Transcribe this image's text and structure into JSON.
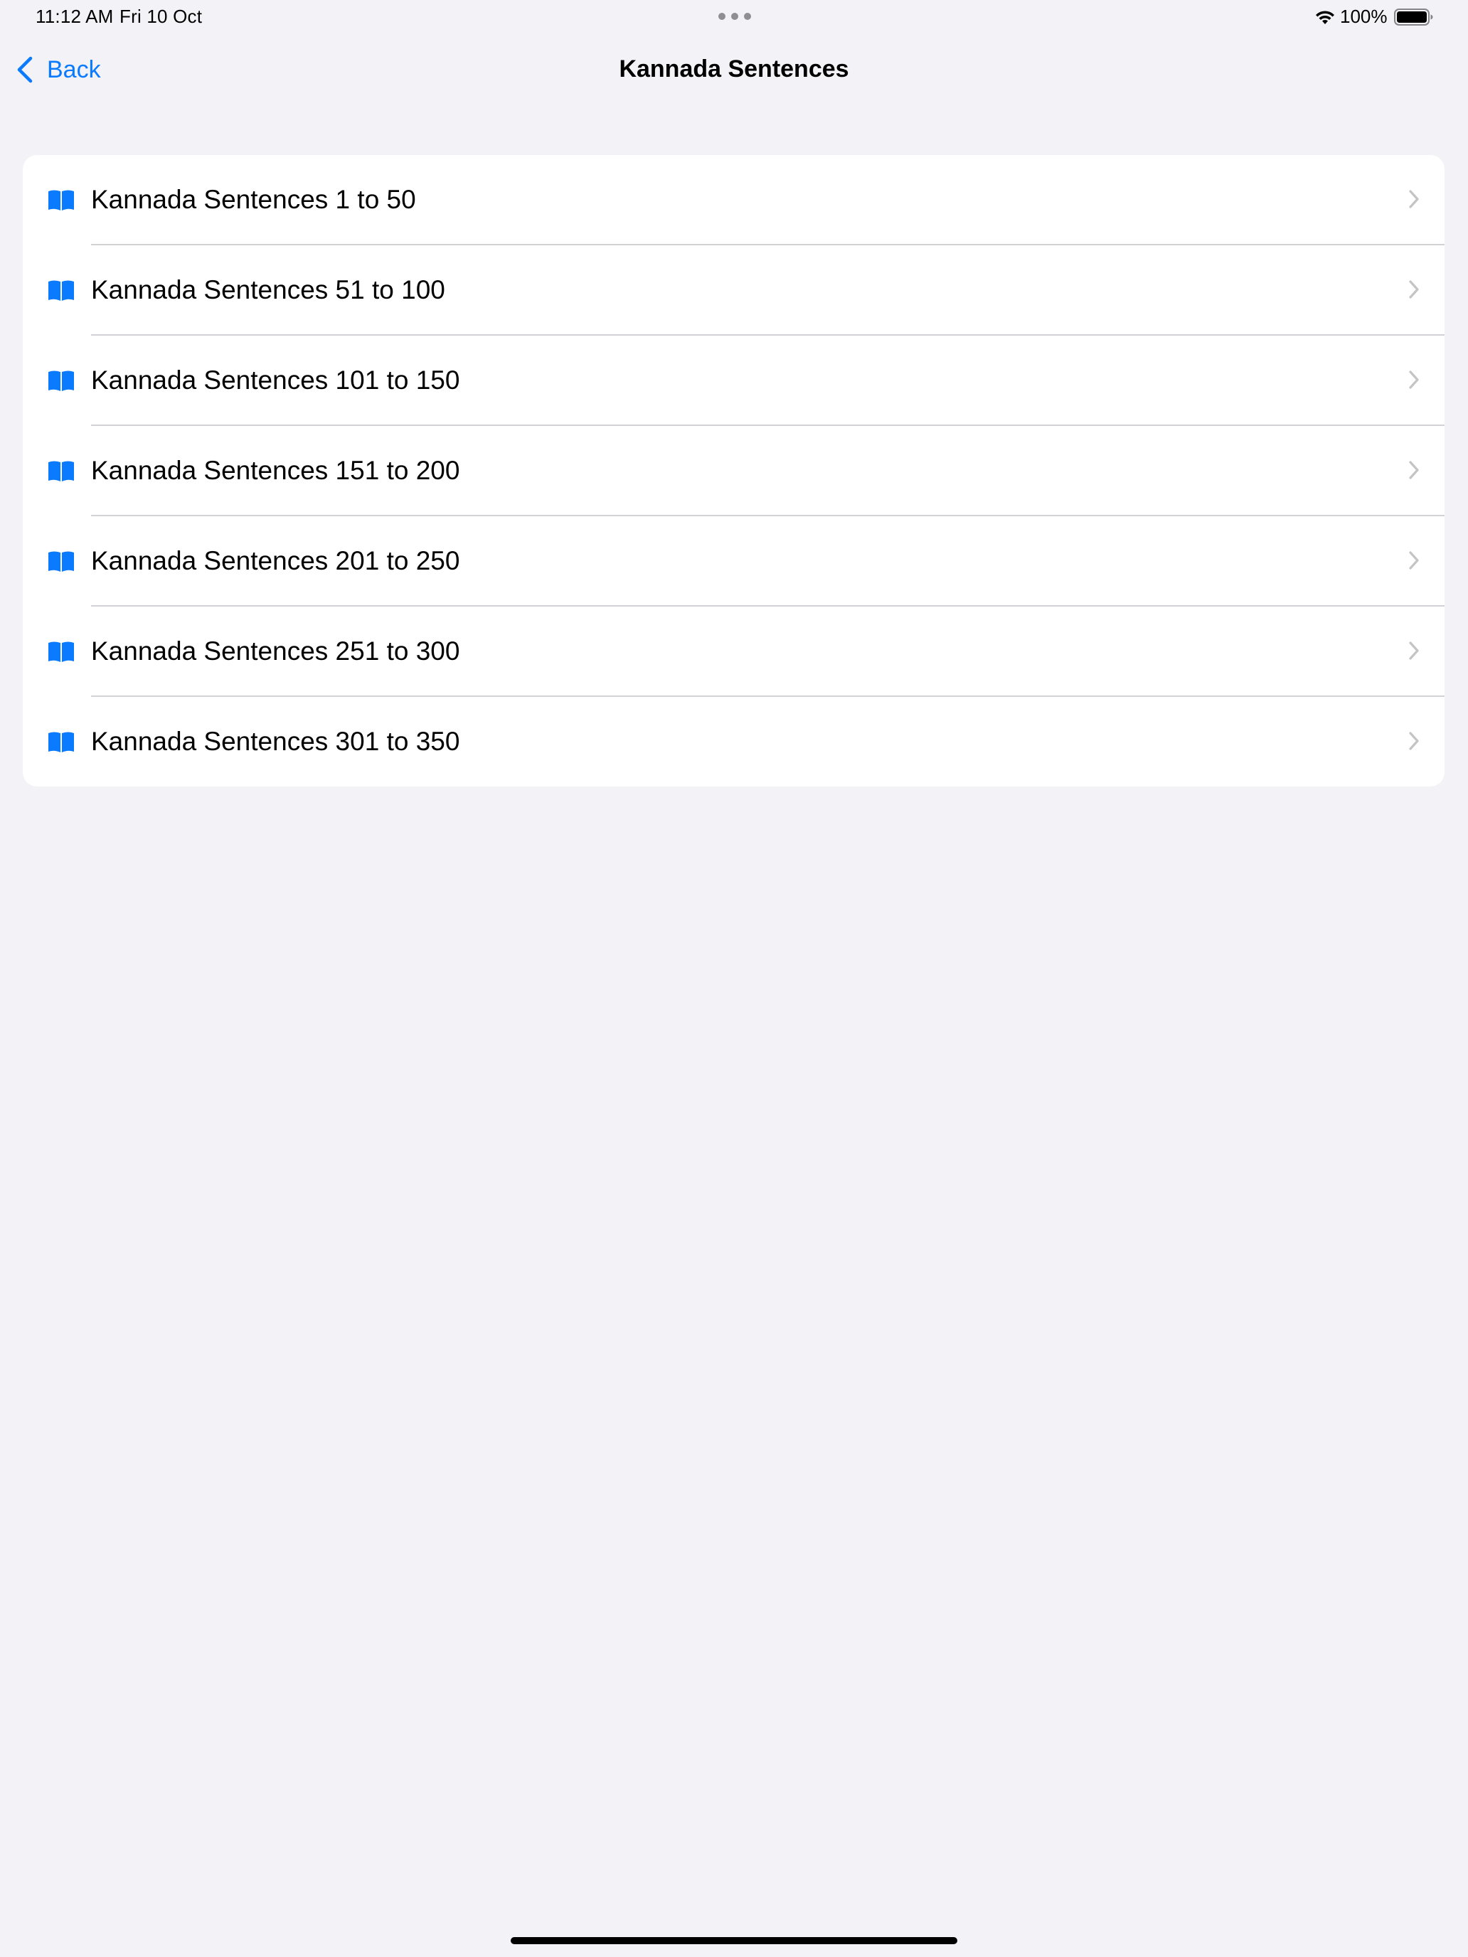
{
  "status_bar": {
    "time": "11:12 AM",
    "date": "Fri 10 Oct",
    "battery_percent": "100%",
    "battery_level": 1.0,
    "icons": [
      "wifi-icon",
      "battery-icon",
      "multitask-dots-icon"
    ]
  },
  "nav": {
    "back_label": "Back",
    "title": "Kannada Sentences"
  },
  "list": {
    "items": [
      {
        "label": "Kannada Sentences 1 to 50",
        "icon": "book-icon"
      },
      {
        "label": "Kannada Sentences 51 to 100",
        "icon": "book-icon"
      },
      {
        "label": "Kannada Sentences 101 to 150",
        "icon": "book-icon"
      },
      {
        "label": "Kannada Sentences 151 to 200",
        "icon": "book-icon"
      },
      {
        "label": "Kannada Sentences 201 to 250",
        "icon": "book-icon"
      },
      {
        "label": "Kannada Sentences 251 to 300",
        "icon": "book-icon"
      },
      {
        "label": "Kannada Sentences 301 to 350",
        "icon": "book-icon"
      }
    ]
  },
  "colors": {
    "background": "#F2F2F7",
    "card": "#FFFFFF",
    "accent": "#0A7AFF",
    "separator": "#D1D1D6",
    "chevron": "#C4C4C7"
  }
}
